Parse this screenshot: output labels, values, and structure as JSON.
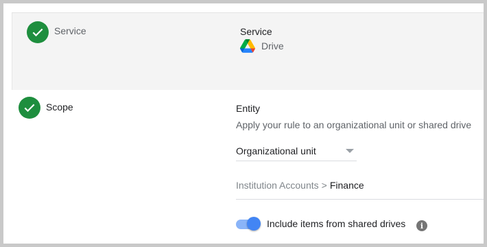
{
  "service_step": {
    "title": "Service",
    "field_label": "Service",
    "field_value": "Drive",
    "status_icon": "check-icon",
    "logo_icon": "google-drive-icon"
  },
  "scope_step": {
    "title": "Scope",
    "status_icon": "check-icon",
    "entity_label": "Entity",
    "entity_help": "Apply your rule to an organizational unit or shared drive",
    "entity_select": {
      "selected": "Organizational unit"
    },
    "org_path": {
      "root": "Institution Accounts",
      "separator": ">",
      "leaf": "Finance"
    },
    "shared_drives_toggle": {
      "label": "Include items from shared drives",
      "checked": true,
      "info_icon": "info-icon"
    }
  },
  "colors": {
    "success_green": "#1e8e3e",
    "toggle_blue": "#4285f4",
    "toggle_track": "#8ab4f8",
    "collapsed_step_bg": "#f4f4f4"
  }
}
